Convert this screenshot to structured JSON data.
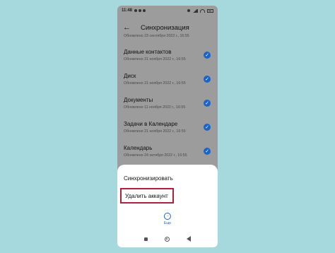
{
  "status_bar": {
    "time": "11:48"
  },
  "header": {
    "back_icon": "arrow-left-icon",
    "title": "Синхронизация"
  },
  "partial_item": {
    "subtitle": "Обновлено 23 сентября 2022 г., 16:55"
  },
  "sync_items": [
    {
      "title": "Данные контактов",
      "subtitle": "Обновлено 21 ноября 2022 г., 16:55",
      "checked": true
    },
    {
      "title": "Диск",
      "subtitle": "Обновлено 21 ноября 2022 г., 16:55",
      "checked": true
    },
    {
      "title": "Документы",
      "subtitle": "Обновлено 11 ноября 2022 г., 16:55",
      "checked": true
    },
    {
      "title": "Задачи в Календаре",
      "subtitle": "Обновлено 21 ноября 2022 г., 16:55",
      "checked": true
    },
    {
      "title": "Календарь",
      "subtitle": "Обновлено 24 октября 2022 г., 16:55",
      "checked": true
    }
  ],
  "sheet": {
    "sync_label": "Синхронизировать",
    "delete_label": "Удалить аккаунт",
    "more_label": "Еще",
    "more_icon": "more-horizontal-icon"
  },
  "colors": {
    "accent": "#1a64c9",
    "highlight_border": "#b0203a",
    "background": "#a6d9de",
    "dim_overlay": "#9c9c9c"
  }
}
